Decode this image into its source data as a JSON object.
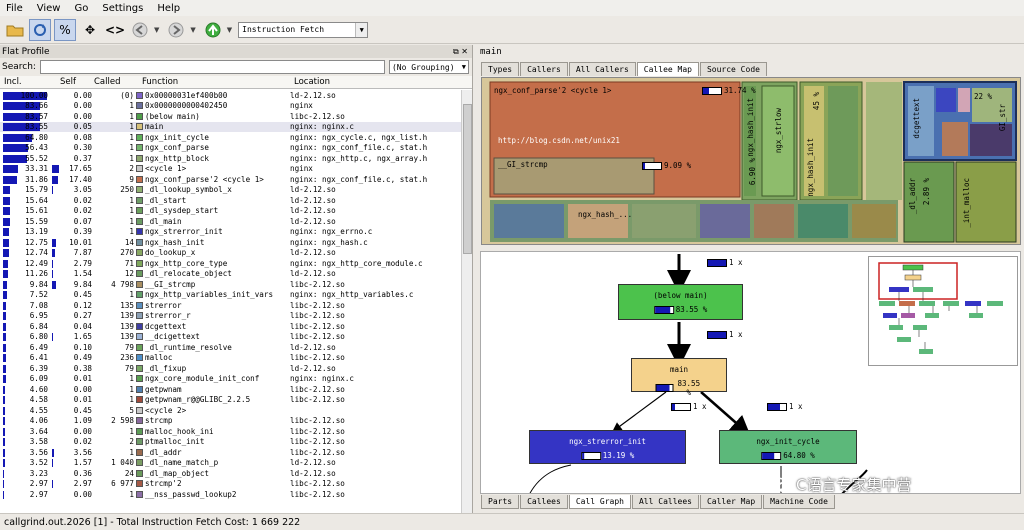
{
  "menu": [
    "File",
    "View",
    "Go",
    "Settings",
    "Help"
  ],
  "toolbar": {
    "event_type": "Instruction Fetch"
  },
  "left": {
    "title": "Flat Profile",
    "search_label": "Search:",
    "grouping": "(No Grouping)",
    "columns": [
      "Incl.",
      "Self",
      "Called",
      "Function",
      "Location"
    ],
    "rows": [
      {
        "incl": "100.00",
        "self": "0.00",
        "called": "(0)",
        "func": "0x00000031ef400b00",
        "loc": "ld-2.12.so",
        "ib": 1.0,
        "sb": 0,
        "color": "#7d63c9"
      },
      {
        "incl": "83.66",
        "self": "0.00",
        "called": "1",
        "func": "0x0000000000402450",
        "loc": "nginx",
        "ib": 0.84,
        "sb": 0,
        "color": "#6a6f9e"
      },
      {
        "incl": "83.57",
        "self": "0.00",
        "called": "1",
        "func": "(below main)",
        "loc": "libc-2.12.so",
        "ib": 0.84,
        "sb": 0,
        "color": "#4f9e4a"
      },
      {
        "incl": "83.55",
        "self": "0.05",
        "called": "1",
        "func": "main",
        "loc": "nginx: nginx.c",
        "ib": 0.84,
        "sb": 0,
        "color": "#d6c17a"
      },
      {
        "incl": "64.80",
        "self": "0.08",
        "called": "1",
        "func": "ngx_init_cycle",
        "loc": "nginx: ngx_cycle.c, ngx_list.h",
        "ib": 0.65,
        "sb": 0,
        "color": "#5fb05a"
      },
      {
        "incl": "56.43",
        "self": "0.30",
        "called": "1",
        "func": "ngx_conf_parse",
        "loc": "nginx: ngx_conf_file.c, stat.h",
        "ib": 0.56,
        "sb": 0,
        "color": "#73b46c"
      },
      {
        "incl": "55.52",
        "self": "0.37",
        "called": "1",
        "func": "ngx_http_block",
        "loc": "nginx: ngx_http.c, ngx_array.h",
        "ib": 0.55,
        "sb": 0,
        "color": "#8fa870"
      },
      {
        "incl": "33.31",
        "self": "17.65",
        "called": "2",
        "func": "<cycle 1>",
        "loc": "nginx",
        "ib": 0.33,
        "sb": 0.18,
        "color": "#c9c9c9"
      },
      {
        "incl": "31.86",
        "self": "17.40",
        "called": "9",
        "func": "ngx_conf_parse'2 <cycle 1>",
        "loc": "nginx: ngx_conf_file.c, stat.h",
        "ib": 0.32,
        "sb": 0.17,
        "color": "#c46e4a"
      },
      {
        "incl": "15.79",
        "self": "3.05",
        "called": "250",
        "func": "_dl_lookup_symbol_x",
        "loc": "ld-2.12.so",
        "ib": 0.16,
        "sb": 0.03,
        "color": "#8fb06f"
      },
      {
        "incl": "15.64",
        "self": "0.02",
        "called": "1",
        "func": "_dl_start",
        "loc": "ld-2.12.so",
        "ib": 0.16,
        "sb": 0,
        "color": "#6e9e67"
      },
      {
        "incl": "15.61",
        "self": "0.02",
        "called": "1",
        "func": "_dl_sysdep_start",
        "loc": "ld-2.12.so",
        "ib": 0.16,
        "sb": 0,
        "color": "#6aa05c"
      },
      {
        "incl": "15.59",
        "self": "0.07",
        "called": "1",
        "func": "_dl_main",
        "loc": "ld-2.12.so",
        "ib": 0.16,
        "sb": 0,
        "color": "#6a9b62"
      },
      {
        "incl": "13.19",
        "self": "0.39",
        "called": "1",
        "func": "ngx_strerror_init",
        "loc": "nginx: ngx_errno.c",
        "ib": 0.13,
        "sb": 0,
        "color": "#3434b0"
      },
      {
        "incl": "12.75",
        "self": "10.01",
        "called": "14",
        "func": "ngx_hash_init",
        "loc": "nginx: ngx_hash.c",
        "ib": 0.13,
        "sb": 0.1,
        "color": "#6f8fa0"
      },
      {
        "incl": "12.74",
        "self": "7.87",
        "called": "270",
        "func": "do_lookup_x",
        "loc": "ld-2.12.so",
        "ib": 0.13,
        "sb": 0.08,
        "color": "#88a862"
      },
      {
        "incl": "12.49",
        "self": "2.79",
        "called": "71",
        "func": "ngx_http_core_type",
        "loc": "nginx: ngx_http_core_module.c",
        "ib": 0.12,
        "sb": 0.03,
        "color": "#7fa85c"
      },
      {
        "incl": "11.26",
        "self": "1.54",
        "called": "12",
        "func": "_dl_relocate_object",
        "loc": "ld-2.12.so",
        "ib": 0.11,
        "sb": 0.02,
        "color": "#6b9c60"
      },
      {
        "incl": "9.84",
        "self": "9.84",
        "called": "4 798",
        "func": "__GI_strcmp",
        "loc": "libc-2.12.so",
        "ib": 0.1,
        "sb": 0.1,
        "color": "#a98f62"
      },
      {
        "incl": "7.52",
        "self": "0.45",
        "called": "1",
        "func": "ngx_http_variables_init_vars",
        "loc": "nginx: ngx_http_variables.c",
        "ib": 0.08,
        "sb": 0,
        "color": "#62a06a"
      },
      {
        "incl": "7.08",
        "self": "0.12",
        "called": "135",
        "func": "strerror",
        "loc": "libc-2.12.so",
        "ib": 0.07,
        "sb": 0,
        "color": "#5a8fbf"
      },
      {
        "incl": "6.95",
        "self": "0.27",
        "called": "139",
        "func": "strerror_r",
        "loc": "libc-2.12.so",
        "ib": 0.07,
        "sb": 0,
        "color": "#8ba0b5"
      },
      {
        "incl": "6.84",
        "self": "0.04",
        "called": "139",
        "func": "dcgettext",
        "loc": "libc-2.12.so",
        "ib": 0.07,
        "sb": 0,
        "color": "#3f3fa3"
      },
      {
        "incl": "6.80",
        "self": "1.65",
        "called": "139",
        "func": "__dcigettext",
        "loc": "libc-2.12.so",
        "ib": 0.07,
        "sb": 0.02,
        "color": "#9cb3d6"
      },
      {
        "incl": "6.49",
        "self": "0.10",
        "called": "79",
        "func": "_dl_runtime_resolve",
        "loc": "ld-2.12.so",
        "ib": 0.06,
        "sb": 0,
        "color": "#6aa45a"
      },
      {
        "incl": "6.41",
        "self": "0.49",
        "called": "236",
        "func": "malloc",
        "loc": "libc-2.12.so",
        "ib": 0.06,
        "sb": 0,
        "color": "#4e8fc9"
      },
      {
        "incl": "6.39",
        "self": "0.38",
        "called": "79",
        "func": "_dl_fixup",
        "loc": "ld-2.12.so",
        "ib": 0.06,
        "sb": 0,
        "color": "#7aa865"
      },
      {
        "incl": "6.09",
        "self": "0.01",
        "called": "1",
        "func": "ngx_core_module_init_conf",
        "loc": "nginx: nginx.c",
        "ib": 0.06,
        "sb": 0,
        "color": "#5aa050"
      },
      {
        "incl": "4.60",
        "self": "0.00",
        "called": "1",
        "func": "getpwnam",
        "loc": "libc-2.12.so",
        "ib": 0.05,
        "sb": 0,
        "color": "#4e7fb0"
      },
      {
        "incl": "4.58",
        "self": "0.01",
        "called": "1",
        "func": "getpwnam_r@@GLIBC_2.2.5",
        "loc": "libc-2.12.so",
        "ib": 0.05,
        "sb": 0,
        "color": "#a04a3a"
      },
      {
        "incl": "4.55",
        "self": "0.45",
        "called": "5",
        "func": "<cycle 2>",
        "loc": "",
        "ib": 0.05,
        "sb": 0,
        "color": "#c9c9c9"
      },
      {
        "incl": "4.06",
        "self": "1.09",
        "called": "2 598",
        "func": "strcmp",
        "loc": "libc-2.12.so",
        "ib": 0.04,
        "sb": 0.01,
        "color": "#8a6a9e"
      },
      {
        "incl": "3.64",
        "self": "0.00",
        "called": "1",
        "func": "malloc_hook_ini",
        "loc": "libc-2.12.so",
        "ib": 0.04,
        "sb": 0,
        "color": "#5c9c56"
      },
      {
        "incl": "3.58",
        "self": "0.02",
        "called": "2",
        "func": "ptmalloc_init",
        "loc": "libc-2.12.so",
        "ib": 0.04,
        "sb": 0,
        "color": "#6d9a67"
      },
      {
        "incl": "3.56",
        "self": "3.56",
        "called": "1",
        "func": "_dl_addr",
        "loc": "libc-2.12.so",
        "ib": 0.04,
        "sb": 0.04,
        "color": "#9a6b4e"
      },
      {
        "incl": "3.52",
        "self": "1.57",
        "called": "1 040",
        "func": "_dl_name_match_p",
        "loc": "ld-2.12.so",
        "ib": 0.04,
        "sb": 0.02,
        "color": "#7b9d64"
      },
      {
        "incl": "3.23",
        "self": "0.36",
        "called": "24",
        "func": "_dl_map_object",
        "loc": "ld-2.12.so",
        "ib": 0.03,
        "sb": 0,
        "color": "#6b9a5c"
      },
      {
        "incl": "2.97",
        "self": "2.97",
        "called": "6 977",
        "func": "strcmp'2",
        "loc": "libc-2.12.so",
        "ib": 0.03,
        "sb": 0.03,
        "color": "#a55a46"
      },
      {
        "incl": "2.97",
        "self": "0.00",
        "called": "1",
        "func": "__nss_passwd_lookup2",
        "loc": "libc-2.12.so",
        "ib": 0.03,
        "sb": 0,
        "color": "#8c6fa7"
      }
    ]
  },
  "right": {
    "title": "main",
    "tabs": [
      "Types",
      "Callers",
      "All Callers",
      "Callee Map",
      "Source Code"
    ],
    "active_tab": "Callee Map",
    "treemap_labels": {
      "conf_parse": "ngx_conf_parse'2 <cycle 1>",
      "conf_parse_pct": "31.74 %",
      "strcmp": "__GI_strcmp",
      "strcmp_pct": "9.09 %",
      "url": "http://blog.csdn.net/unix21",
      "hash": "ngx_hash_...",
      "hash_init": "ngx_hash_init",
      "hash_init_pct": "6.90 %",
      "strlow": "ngx_strlow",
      "hash_init2": "ngx_hash_init",
      "dcgettext": "dcgettext",
      "pct_22": "22 %",
      "gi_str": "GI_str",
      "dl_addr": "_dl_addr",
      "dl_addr_pct": "2.89 %",
      "init_malloc": "_int_malloc",
      "pct_45": "45 %"
    },
    "graph": {
      "top_label": "1 x",
      "below_main": {
        "name": "(below main)",
        "pct": "83.55 %"
      },
      "edge1": "1 x",
      "main": {
        "name": "main",
        "pct": "83.55 %"
      },
      "edge_left": "1 x",
      "edge_right": "1 x",
      "strerror_init": {
        "name": "ngx_strerror_init",
        "pct": "13.19 %"
      },
      "init_cycle": {
        "name": "ngx_init_cycle",
        "pct": "64.80 %"
      }
    },
    "bottom_tabs": [
      "Parts",
      "Callees",
      "Call Graph",
      "All Callees",
      "Caller Map",
      "Machine Code"
    ],
    "active_bottom_tab": "Call Graph"
  },
  "status": "callgrind.out.2026 [1] - Total Instruction Fetch Cost: 1 669 222",
  "watermark": "C语言专家集中营"
}
